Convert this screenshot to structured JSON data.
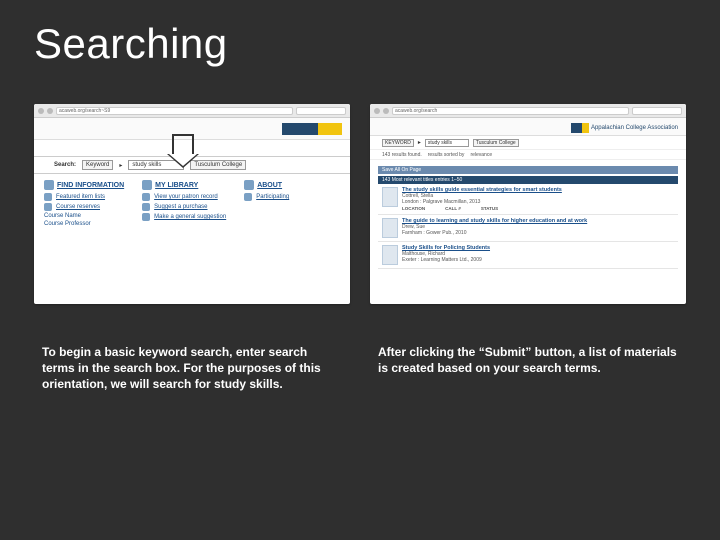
{
  "title": "Searching",
  "shot1": {
    "url": "acaweb.org/search~S9",
    "search": {
      "label": "Search:",
      "type": "Keyword",
      "value": "study skills",
      "scope": "Tusculum College"
    },
    "columns": {
      "find": {
        "heading": "FIND INFORMATION",
        "links": [
          "Featured item lists",
          "Course reserves"
        ],
        "sub": [
          "Course Name",
          "Course Professor"
        ]
      },
      "mylib": {
        "heading": "MY LIBRARY",
        "links": [
          "View your patron record",
          "Suggest a purchase",
          "Make a general suggestion"
        ]
      },
      "about": {
        "heading": "ABOUT",
        "links": [
          "Participating"
        ]
      }
    }
  },
  "shot2": {
    "url": "acaweb.org/search",
    "brand": "Appalachian College Association",
    "search": {
      "type": "KEYWORD",
      "value": "study skills",
      "scope": "Tusculum College",
      "sort": "relevance"
    },
    "meta": {
      "resultline": "results sorted by",
      "hits": "143 results found."
    },
    "savebar": "Save All On Page",
    "hitbar": "143 Most relevant titles entries 1–50",
    "results": [
      {
        "title": "The study skills guide essential strategies for smart students",
        "author": "Cottrell, Stella",
        "pub": "London : Palgrave Macmillan, 2013",
        "loc": "LOCATION",
        "call": "CALL #",
        "status": "STATUS"
      },
      {
        "title": "The guide to learning and study skills for higher education and at work",
        "author": "Drew, Sue",
        "pub": "Farnham : Gower Pub., 2010"
      },
      {
        "title": "Study Skills for Policing Students",
        "author": "Malthouse, Richard",
        "pub": "Exeter : Learning Matters Ltd., 2009"
      }
    ]
  },
  "captions": {
    "left": "To begin a basic keyword search, enter search terms in the search box. For the purposes of this orientation, we will search for study skills.",
    "right": "After clicking the “Submit” button, a list of materials is created based on your search terms."
  }
}
